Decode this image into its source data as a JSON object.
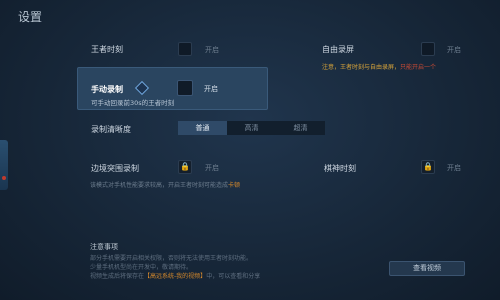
{
  "title": "设置",
  "king_moment": {
    "label": "王者时刻",
    "toggle": "开启"
  },
  "free_record": {
    "label": "自由录屏",
    "toggle": "开启",
    "warn_prefix": "注意，王者时刻与自由录屏，",
    "warn_suffix": "只能开启一个"
  },
  "manual_record": {
    "label": "手动录制",
    "toggle": "开启",
    "sub": "可手动回录前30s的王者时刻"
  },
  "quality": {
    "label": "录制清晰度",
    "options": [
      "普通",
      "高清",
      "超清"
    ]
  },
  "border_record": {
    "label": "边境突围录制",
    "toggle": "开启",
    "note_prefix": "该模式对手机性能要求较高，开启王者时刻可能造成",
    "note_hl": "卡顿"
  },
  "chess_moment": {
    "label": "棋神时刻",
    "toggle": "开启"
  },
  "notes": {
    "title": "注意事项",
    "line1": "部分手机需要开启相关权限，否则将无法使用王者时刻功能。",
    "line2": "少量手机机型尚在开发中，敬请期待。",
    "line3_prefix": "视频生成后将保存在",
    "line3_hl": "【高远系统-我的视频】",
    "line3_suffix": "中，可以查看和分享",
    "view_button": "查看视频"
  },
  "lock_glyph": "🔒"
}
